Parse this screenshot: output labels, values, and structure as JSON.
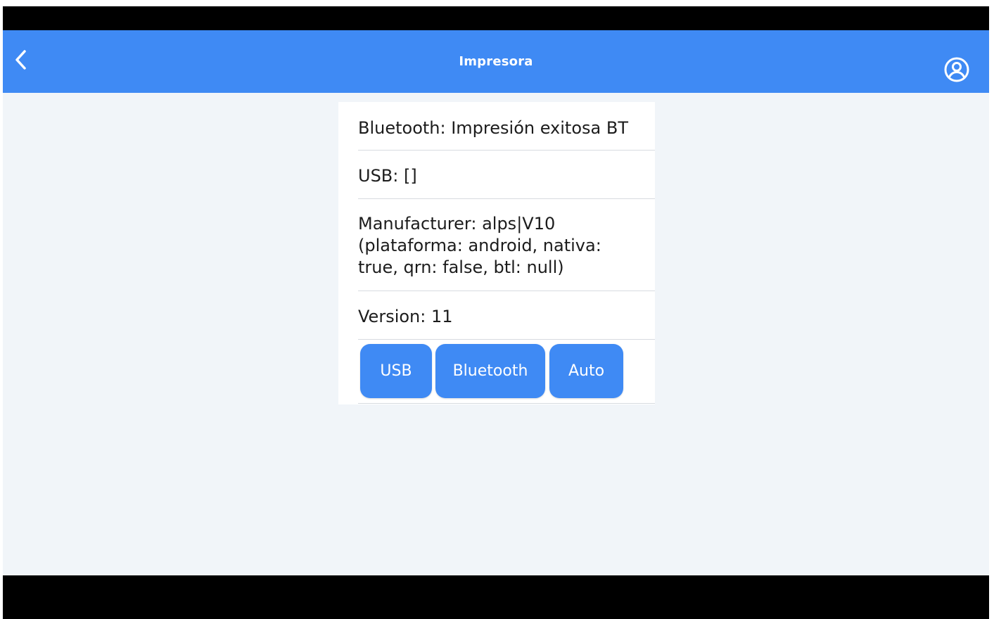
{
  "app_bar": {
    "title": "Impresora",
    "back_icon": "chevron-left-icon",
    "account_icon": "account-circle-icon",
    "color": "#3f8af4"
  },
  "info": {
    "bluetooth": "Bluetooth: Impresión exitosa BT",
    "usb": "USB: []",
    "manufacturer": "Manufacturer: alps|V10 (plataforma: android, nativa: true, qrn: false, btl: null)",
    "version": "Version: 11"
  },
  "buttons": {
    "usb_label": "USB",
    "bluetooth_label": "Bluetooth",
    "auto_label": "Auto"
  },
  "colors": {
    "accent": "#3f8af4",
    "background": "#f1f5f9",
    "card": "#ffffff"
  }
}
